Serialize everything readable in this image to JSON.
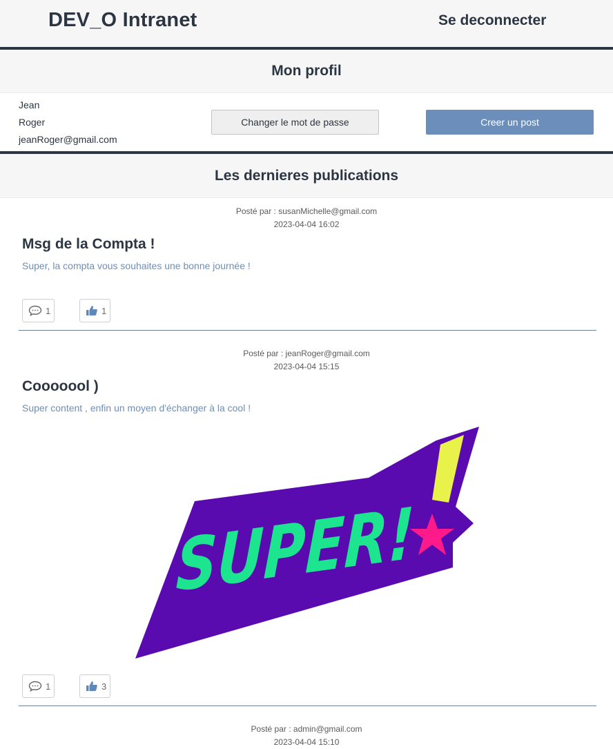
{
  "header": {
    "brand": "DEV_O Intranet",
    "logout_label": "Se deconnecter"
  },
  "profile": {
    "section_title": "Mon profil",
    "first_name": "Jean",
    "last_name": "Roger",
    "email": "jeanRoger@gmail.com",
    "change_password_label": "Changer le mot de passe",
    "create_post_label": "Creer un post"
  },
  "feed": {
    "section_title": "Les dernieres publications",
    "posts": [
      {
        "author": "Posté par : susanMichelle@gmail.com",
        "date": "2023-04-04 16:02",
        "title": "Msg de la Compta !",
        "body": "Super, la compta vous souhaites une bonne journée !",
        "comments": "1",
        "likes": "1"
      },
      {
        "author": "Posté par : jeanRoger@gmail.com",
        "date": "2023-04-04 15:15",
        "title": "Cooooool )",
        "body": "Super content , enfin un moyen d'échanger à la cool !",
        "image_text": "SUPER!",
        "comments": "1",
        "likes": "3"
      },
      {
        "author": "Posté par : admin@gmail.com",
        "date": "2023-04-04 15:10"
      }
    ]
  },
  "colors": {
    "navy": "#2c3542",
    "accent_blue": "#6b8fba",
    "band_grey": "#f6f6f6",
    "sticker_purple": "#5a0bb0",
    "sticker_green": "#1de58f",
    "sticker_yellow": "#e9f24b",
    "sticker_pink": "#ff1a8c"
  },
  "icons": {
    "comment": "speech-bubble-icon",
    "like": "thumbs-up-icon"
  }
}
